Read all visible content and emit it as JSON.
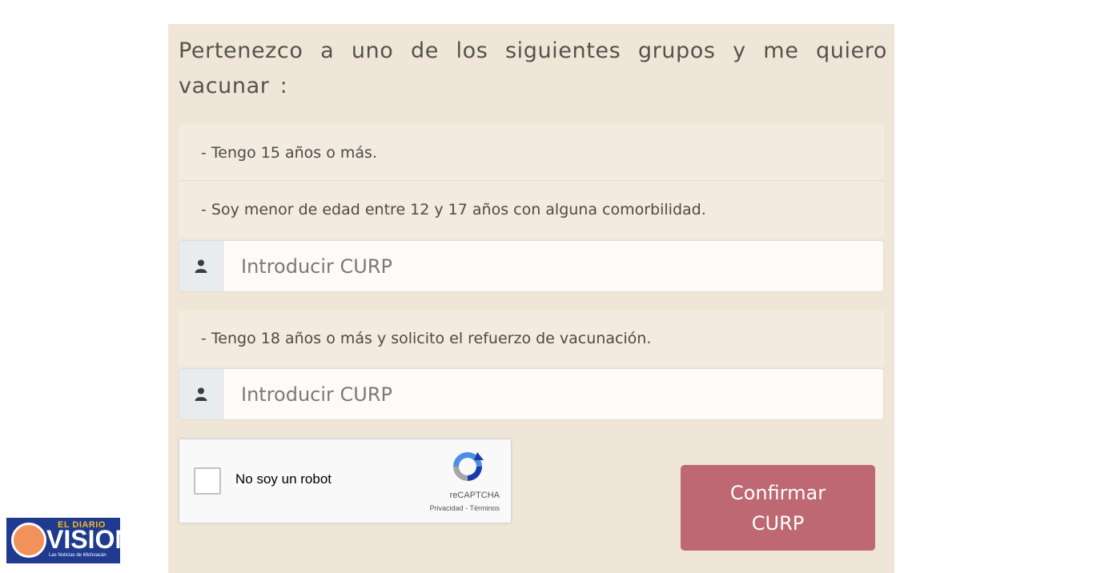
{
  "form": {
    "heading": "Pertenezco a uno de los siguientes grupos y me quiero vacunar :",
    "groups": [
      {
        "label": "- Tengo 15 años o más."
      },
      {
        "label": "- Soy menor de edad entre 12 y 17 años con alguna comorbilidad."
      },
      {
        "label": "- Tengo 18 años o más y solicito el refuerzo de vacunación."
      }
    ],
    "curp_inputs": [
      {
        "placeholder": "Introducir CURP",
        "value": ""
      },
      {
        "placeholder": "Introducir CURP",
        "value": ""
      }
    ],
    "confirm_label": "Confirmar CURP"
  },
  "captcha": {
    "label": "No soy un robot",
    "brand": "reCAPTCHA",
    "links": "Privacidad - Términos",
    "checked": false
  },
  "watermark": {
    "top": "EL DIARIO",
    "main": "VISION",
    "sub": "Las Noticias de Michoacán"
  },
  "colors": {
    "panel_bg": "#efe6d7",
    "button_bg": "#bd6873",
    "logo_bg": "#1f3a8f"
  },
  "icons": {
    "curp_addon": "user-icon",
    "captcha": "recaptcha-logo-icon"
  }
}
